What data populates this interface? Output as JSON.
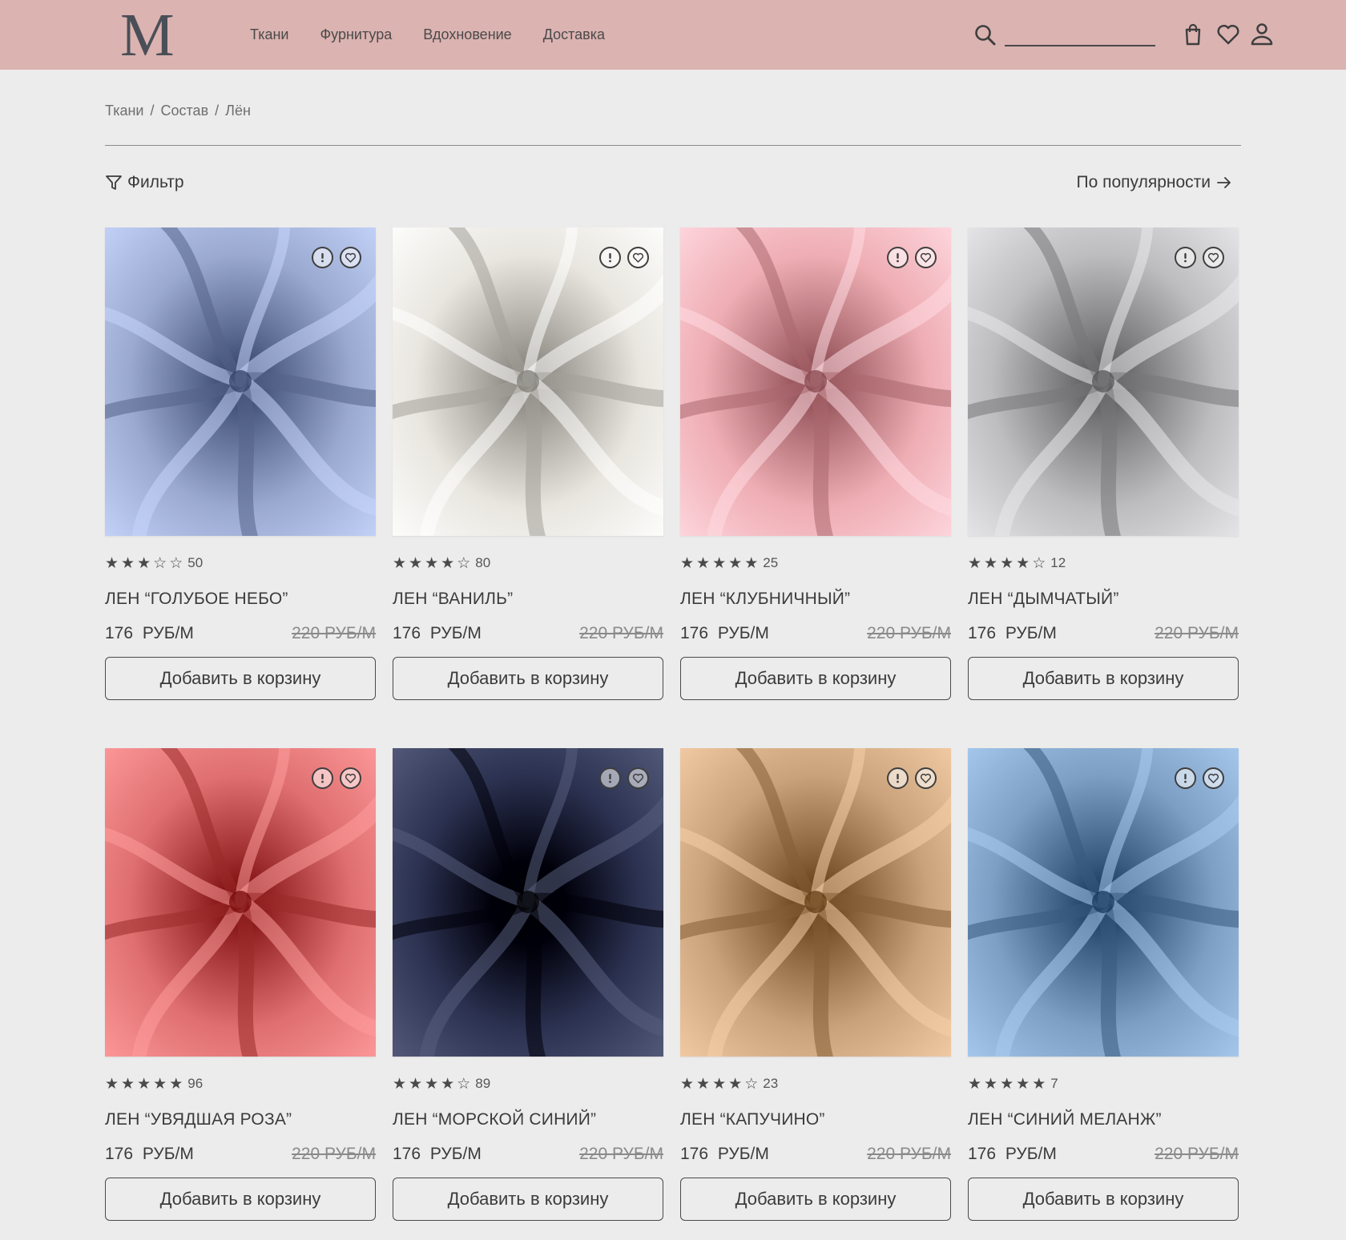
{
  "header": {
    "logo": "M",
    "nav": [
      "Ткани",
      "Фурнитура",
      "Вдохновение",
      "Доставка"
    ],
    "search": {
      "value": "",
      "placeholder": ""
    },
    "icons": [
      "search-icon",
      "bag-icon",
      "heart-icon",
      "user-icon"
    ]
  },
  "breadcrumb": [
    "Ткани",
    "/",
    "Состав",
    "/",
    "Лён"
  ],
  "toolbar": {
    "filter_label": "Фильтр",
    "sort_label": "По популярности"
  },
  "colors": {
    "header_bg": "#dbb3b1",
    "page_bg": "#ececec",
    "text": "#3b3b3b"
  },
  "products": [
    {
      "name": "ЛЕН “ГОЛУБОЕ НЕБО”",
      "rating": 3,
      "reviews": "50",
      "price": "176 РУБ/М",
      "old_price": "220 РУБ/М",
      "button": "Добавить в корзину",
      "fabric_color": "#9aa9cf"
    },
    {
      "name": "ЛЕН “ВАНИЛЬ”",
      "rating": 4,
      "reviews": "80",
      "price": "176 РУБ/М",
      "old_price": "220 РУБ/М",
      "button": "Добавить в корзину",
      "fabric_color": "#e8e6df"
    },
    {
      "name": "ЛЕН “КЛУБНИЧНЫЙ”",
      "rating": 5,
      "reviews": "25",
      "price": "176 РУБ/М",
      "old_price": "220 РУБ/М",
      "button": "Добавить в корзину",
      "fabric_color": "#efadb4"
    },
    {
      "name": "ЛЕН “ДЫМЧАТЫЙ”",
      "rating": 4,
      "reviews": "12",
      "price": "176 РУБ/М",
      "old_price": "220 РУБ/М",
      "button": "Добавить в корзину",
      "fabric_color": "#bdbdbf"
    },
    {
      "name": "ЛЕН “УВЯДШАЯ РОЗА”",
      "rating": 5,
      "reviews": "96",
      "price": "176 РУБ/М",
      "old_price": "220 РУБ/М",
      "button": "Добавить в корзину",
      "fabric_color": "#df6f70"
    },
    {
      "name": "ЛЕН “МОРСКОЙ СИНИЙ”",
      "rating": 4,
      "reviews": "89",
      "price": "176 РУБ/М",
      "old_price": "220 РУБ/М",
      "button": "Добавить в корзину",
      "fabric_color": "#2b3150"
    },
    {
      "name": "ЛЕН “КАПУЧИНО”",
      "rating": 4,
      "reviews": "23",
      "price": "176 РУБ/М",
      "old_price": "220 РУБ/М",
      "button": "Добавить в корзину",
      "fabric_color": "#c9a27b"
    },
    {
      "name": "ЛЕН “СИНИЙ МЕЛАНЖ”",
      "rating": 5,
      "reviews": "7",
      "price": "176 РУБ/М",
      "old_price": "220 РУБ/М",
      "button": "Добавить в корзину",
      "fabric_color": "#7d9fc4"
    }
  ]
}
